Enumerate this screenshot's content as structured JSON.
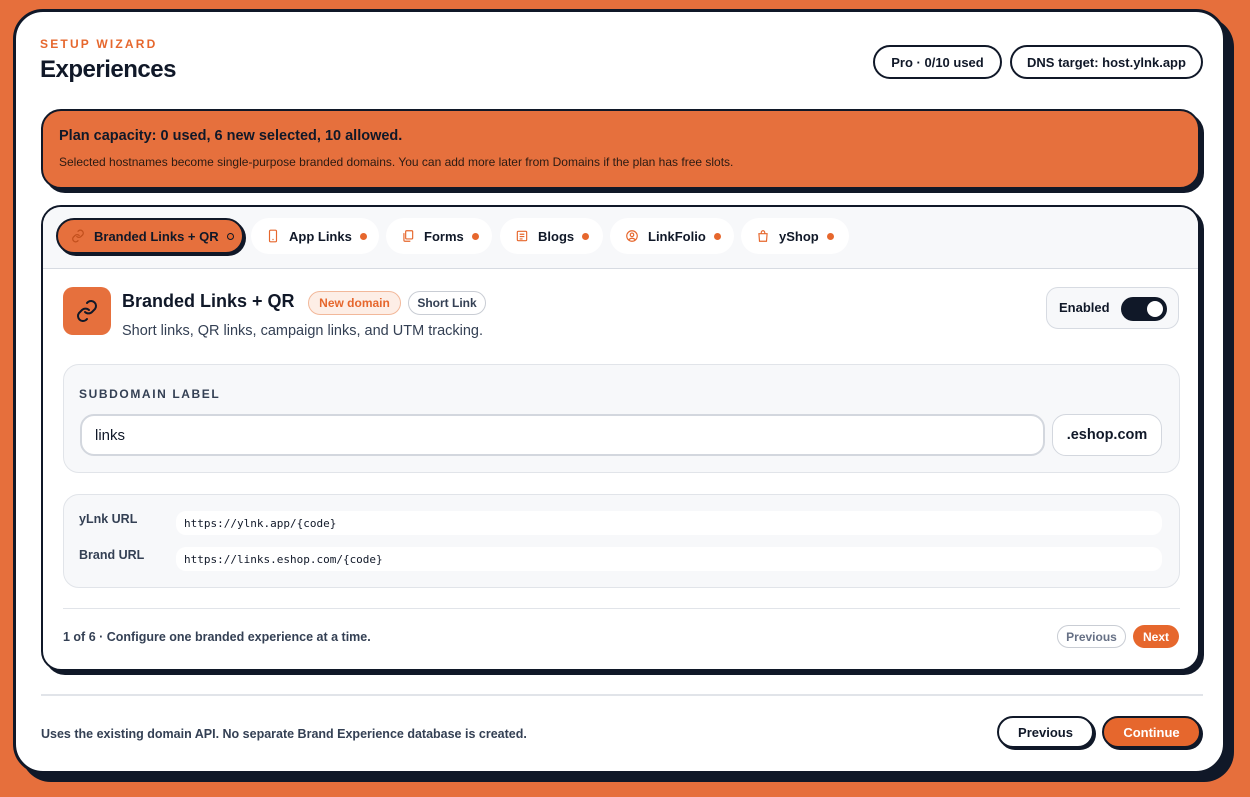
{
  "header": {
    "eyebrow": "SETUP WIZARD",
    "title": "Experiences",
    "plan_pill": "Pro · 0/10 used",
    "dns_pill": "DNS target: host.ylnk.app"
  },
  "alert": {
    "title": "Plan capacity: 0 used, 6 new selected, 10 allowed.",
    "description": "Selected hostnames become single-purpose branded domains. You can add more later from Domains if the plan has free slots."
  },
  "tabs": [
    {
      "label": "Branded Links + QR",
      "icon": "link-icon",
      "active": true
    },
    {
      "label": "App Links",
      "icon": "mobile-icon",
      "active": false
    },
    {
      "label": "Forms",
      "icon": "copy-icon",
      "active": false
    },
    {
      "label": "Blogs",
      "icon": "newspaper-icon",
      "active": false
    },
    {
      "label": "LinkFolio",
      "icon": "user-circle-icon",
      "active": false
    },
    {
      "label": "yShop",
      "icon": "shopping-bag-icon",
      "active": false
    }
  ],
  "experience": {
    "title": "Branded Links + QR",
    "badge_new": "New domain",
    "badge_type": "Short Link",
    "description": "Short links, QR links, campaign links, and UTM tracking.",
    "toggle_label": "Enabled",
    "toggle_on": true,
    "subdomain_label": "SUBDOMAIN LABEL",
    "subdomain_value": "links",
    "domain_suffix": ".eshop.com",
    "urls": [
      {
        "label": "yLnk URL",
        "value": "https://ylnk.app/{code}"
      },
      {
        "label": "Brand URL",
        "value": "https://links.eshop.com/{code}"
      }
    ]
  },
  "pager": {
    "status": "1 of 6 · Configure one branded experience at a time.",
    "previous": "Previous",
    "next": "Next"
  },
  "footer": {
    "note": "Uses the existing domain API. No separate Brand Experience database is created.",
    "previous": "Previous",
    "continue": "Continue"
  },
  "colors": {
    "accent": "#e6672d",
    "background": "#e66f3c",
    "ink": "#101828"
  }
}
